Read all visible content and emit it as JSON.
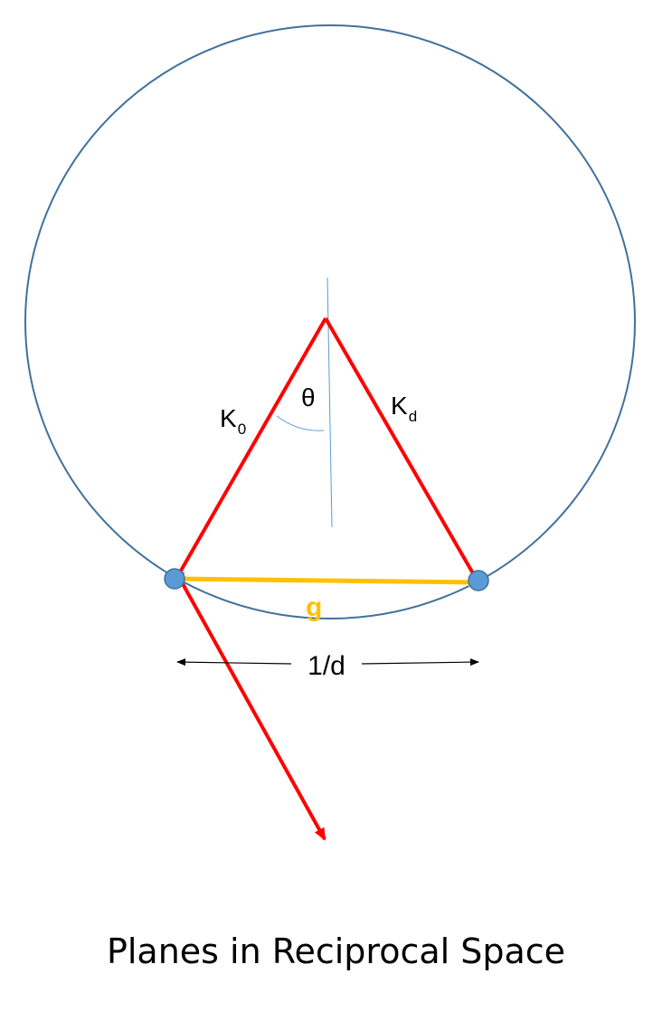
{
  "labels": {
    "theta": "θ",
    "k0_main": "K",
    "k0_sub": "0",
    "kd_main": "K",
    "kd_sub": "d",
    "g": "g",
    "spacing": "1/d"
  },
  "caption": "Planes in Reciprocal Space",
  "colors": {
    "circle": "#41719C",
    "wavevector": "#FF0000",
    "g_vector": "#FFC000",
    "point": "#5B9BD5",
    "axis": "#5B9BD5",
    "text": "#000000"
  }
}
